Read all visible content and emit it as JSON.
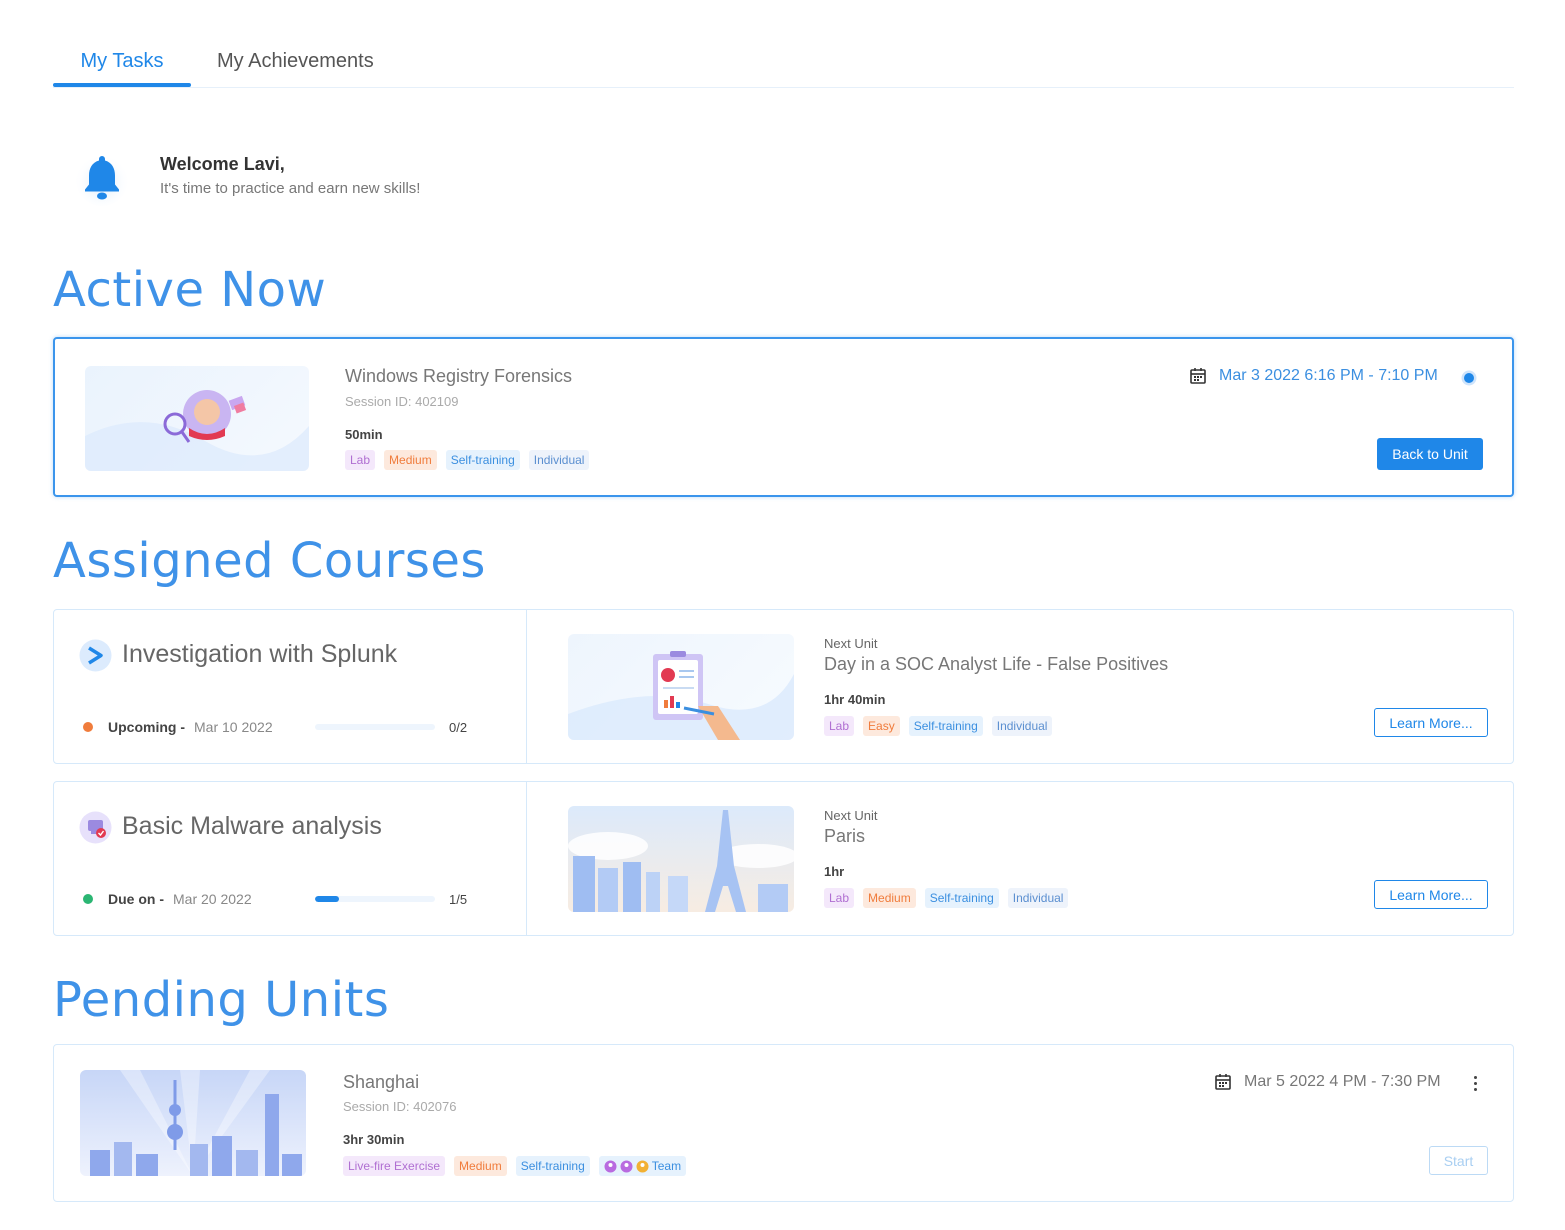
{
  "tabs": {
    "my_tasks": "My Tasks",
    "my_achievements": "My Achievements"
  },
  "welcome": {
    "title": "Welcome Lavi,",
    "subtitle": "It's time to practice and earn new skills!"
  },
  "sections": {
    "active_now": "Active Now",
    "assigned_courses": "Assigned Courses",
    "pending_units": "Pending Units"
  },
  "active_unit": {
    "title": "Windows Registry Forensics",
    "session_id": "Session ID: 402109",
    "duration": "50min",
    "tags": [
      "Lab",
      "Medium",
      "Self-training",
      "Individual"
    ],
    "date": "Mar 3 2022 6:16 PM - 7:10 PM",
    "button": "Back to Unit"
  },
  "courses": [
    {
      "title": "Investigation with Splunk",
      "status_label": "Upcoming -",
      "status_date": "Mar 10 2022",
      "status_color": "#f07c3c",
      "progress": 0,
      "progress_text": "0/2",
      "next_label": "Next Unit",
      "next_title": "Day in a SOC Analyst Life - False Positives",
      "duration": "1hr 40min",
      "tags": [
        "Lab",
        "Easy",
        "Self-training",
        "Individual"
      ],
      "button": "Learn More..."
    },
    {
      "title": "Basic Malware analysis",
      "status_label": "Due on -",
      "status_date": "Mar 20 2022",
      "status_color": "#2bb673",
      "progress": 0.2,
      "progress_text": "1/5",
      "next_label": "Next Unit",
      "next_title": "Paris",
      "duration": "1hr",
      "tags": [
        "Lab",
        "Medium",
        "Self-training",
        "Individual"
      ],
      "button": "Learn More..."
    }
  ],
  "pending_unit": {
    "title": "Shanghai",
    "session_id": "Session ID: 402076",
    "duration": "3hr 30min",
    "tags": [
      "Live-fire Exercise",
      "Medium",
      "Self-training"
    ],
    "team_label": "Team",
    "date": "Mar 5 2022 4 PM - 7:30 PM",
    "button": "Start"
  },
  "colors": {
    "accent": "#1f87e8",
    "heading": "#3f92e8"
  }
}
